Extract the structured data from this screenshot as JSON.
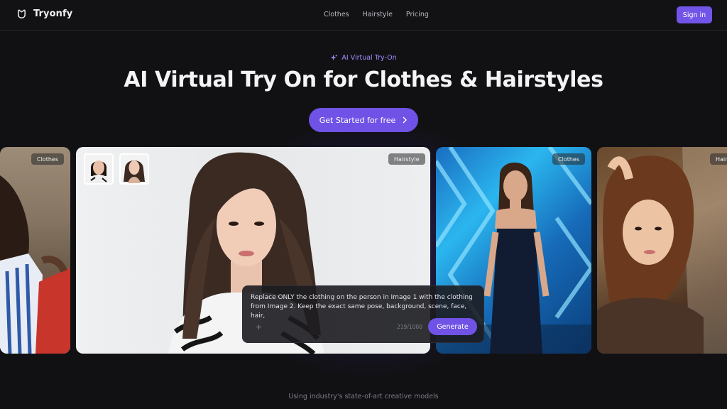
{
  "header": {
    "brand": "Tryonfy",
    "nav": [
      "Clothes",
      "Hairstyle",
      "Pricing"
    ],
    "signin_label": "Sign in"
  },
  "hero": {
    "badge": "AI Virtual Try-On",
    "title": "AI Virtual Try On for Clothes & Hairstyles",
    "cta_label": "Get Started for free"
  },
  "cards": [
    {
      "tag": "Clothes"
    },
    {
      "tag": "Hairstyle"
    },
    {
      "tag": "Clothes"
    },
    {
      "tag": "Hair"
    }
  ],
  "prompt": {
    "text": "Replace ONLY the clothing on the person in Image 1 with the clothing from Image 2. Keep the exact same pose, background, scene, face, hair,",
    "plus": "+",
    "counter": "219/1000",
    "generate_label": "Generate"
  },
  "footer_note": "Using industry's state-of-art creative models",
  "colors": {
    "accent": "#7053e6",
    "badge_text": "#a48cff",
    "background": "#111114"
  }
}
